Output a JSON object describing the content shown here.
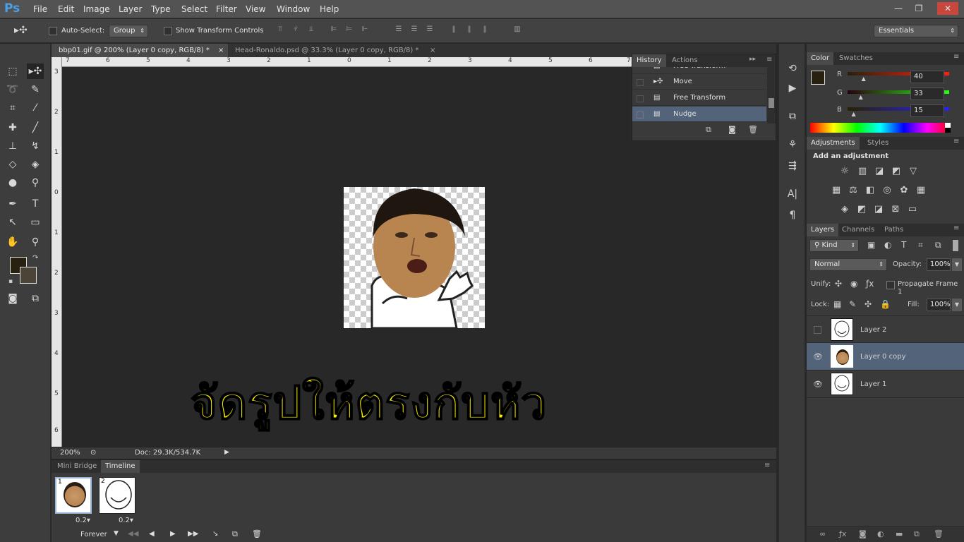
{
  "app": {
    "logo": "Ps"
  },
  "menu": [
    "File",
    "Edit",
    "Image",
    "Layer",
    "Type",
    "Select",
    "Filter",
    "View",
    "Window",
    "Help"
  ],
  "window_controls": {
    "minimize": "—",
    "restore": "❐",
    "close": "✕"
  },
  "options": {
    "auto_select_label": "Auto-Select:",
    "auto_select_value": "Group",
    "show_transform_label": "Show Transform Controls",
    "workspace": "Essentials"
  },
  "tabs": [
    {
      "label": "bbp01.gif @ 200% (Layer 0 copy, RGB/8) *",
      "close": "×"
    },
    {
      "label": "Head-Ronaldo.psd @ 33.3% (Layer 0 copy, RGB/8) *",
      "close": "×"
    }
  ],
  "ruler_top": [
    "7",
    "6",
    "5",
    "4",
    "3",
    "2",
    "1",
    "0",
    "1",
    "2",
    "3",
    "4",
    "5",
    "6",
    "7"
  ],
  "ruler_left": [
    "3",
    "2",
    "1",
    "0",
    "1",
    "2",
    "3",
    "4",
    "5",
    "6"
  ],
  "caption": "จัดรูปให้ตรงกับหัว",
  "status": {
    "zoom": "200%",
    "doc": "Doc: 29.3K/534.7K"
  },
  "history": {
    "tabs": [
      "History",
      "Actions"
    ],
    "items": [
      "Free Transform",
      "Move",
      "Free Transform",
      "Nudge"
    ]
  },
  "timeline": {
    "tabs": [
      "Mini Bridge",
      "Timeline"
    ],
    "frames": [
      {
        "num": "1",
        "delay": "0.2▾"
      },
      {
        "num": "2",
        "delay": "0.2▾"
      }
    ],
    "loop": "Forever"
  },
  "color": {
    "tabs": [
      "Color",
      "Swatches"
    ],
    "channels": [
      {
        "label": "R",
        "value": "40",
        "level": 40
      },
      {
        "label": "G",
        "value": "33",
        "level": 33
      },
      {
        "label": "B",
        "value": "15",
        "level": 15
      }
    ]
  },
  "adjustments": {
    "tabs": [
      "Adjustments",
      "Styles"
    ],
    "title": "Add an adjustment"
  },
  "layers": {
    "tabs": [
      "Layers",
      "Channels",
      "Paths"
    ],
    "kind": "Kind",
    "blend": "Normal",
    "opacity_label": "Opacity:",
    "opacity": "100%",
    "unify_label": "Unify:",
    "propagate": "Propagate Frame 1",
    "lock_label": "Lock:",
    "fill_label": "Fill:",
    "fill": "100%",
    "items": [
      {
        "name": "Layer 2",
        "visible": false,
        "selected": false
      },
      {
        "name": "Layer 0 copy",
        "visible": true,
        "selected": true
      },
      {
        "name": "Layer 1",
        "visible": true,
        "selected": false
      }
    ]
  },
  "colors": {
    "foreground": "#282110",
    "background": "#4a4536",
    "selection": "#53637a"
  }
}
